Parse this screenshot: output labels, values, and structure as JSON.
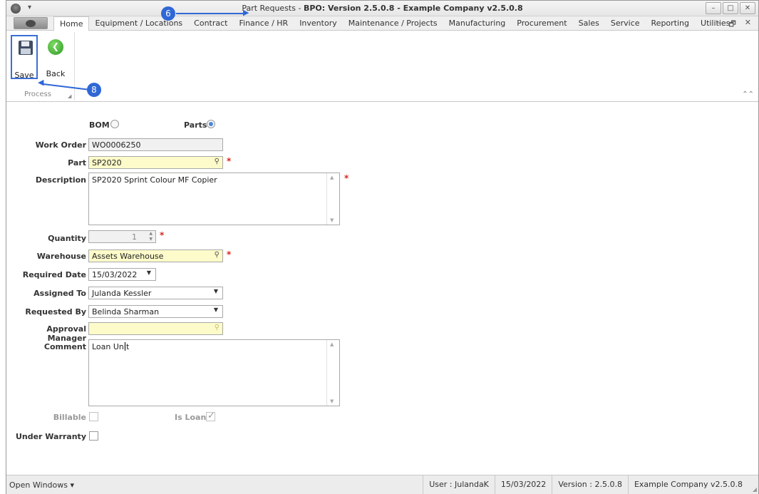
{
  "titlebar": {
    "prefix": "Part Requests - ",
    "bold": "BPO: Version 2.5.0.8 - Example Company v2.5.0.8",
    "minimize": "–",
    "maximize": "□",
    "close": "✕"
  },
  "tabs": [
    "Home",
    "Equipment / Locations",
    "Contract",
    "Finance / HR",
    "Inventory",
    "Maintenance / Projects",
    "Manufacturing",
    "Procurement",
    "Sales",
    "Service",
    "Reporting",
    "Utilities"
  ],
  "mdi": {
    "minimize": "–",
    "restore": "🗗",
    "close": "✕"
  },
  "ribbon": {
    "save_label": "Save",
    "back_label": "Back",
    "group_label": "Process"
  },
  "callouts": {
    "title": "6",
    "save": "8"
  },
  "form": {
    "bom_label": "BOM",
    "parts_label": "Parts",
    "work_order_label": "Work Order",
    "work_order_value": "WO0006250",
    "part_label": "Part",
    "part_value": "SP2020",
    "description_label": "Description",
    "description_value": "SP2020 Sprint Colour MF Copier",
    "quantity_label": "Quantity",
    "quantity_value": "1",
    "warehouse_label": "Warehouse",
    "warehouse_value": "Assets Warehouse",
    "required_date_label": "Required Date",
    "required_date_value": "15/03/2022",
    "assigned_to_label": "Assigned To",
    "assigned_to_value": "Julanda Kessler",
    "requested_by_label": "Requested By",
    "requested_by_value": "Belinda Sharman",
    "approval_manager_label": "Approval Manager",
    "approval_manager_value": "",
    "comment_label": "Comment",
    "comment_value": "Loan Unit",
    "billable_label": "Billable",
    "is_loan_label": "Is Loan",
    "under_warranty_label": "Under Warranty",
    "required_mark": "*"
  },
  "status": {
    "open_windows": "Open Windows ▾",
    "user": "User : JulandaK",
    "date": "15/03/2022",
    "version": "Version : 2.5.0.8",
    "company": "Example Company v2.5.0.8"
  }
}
